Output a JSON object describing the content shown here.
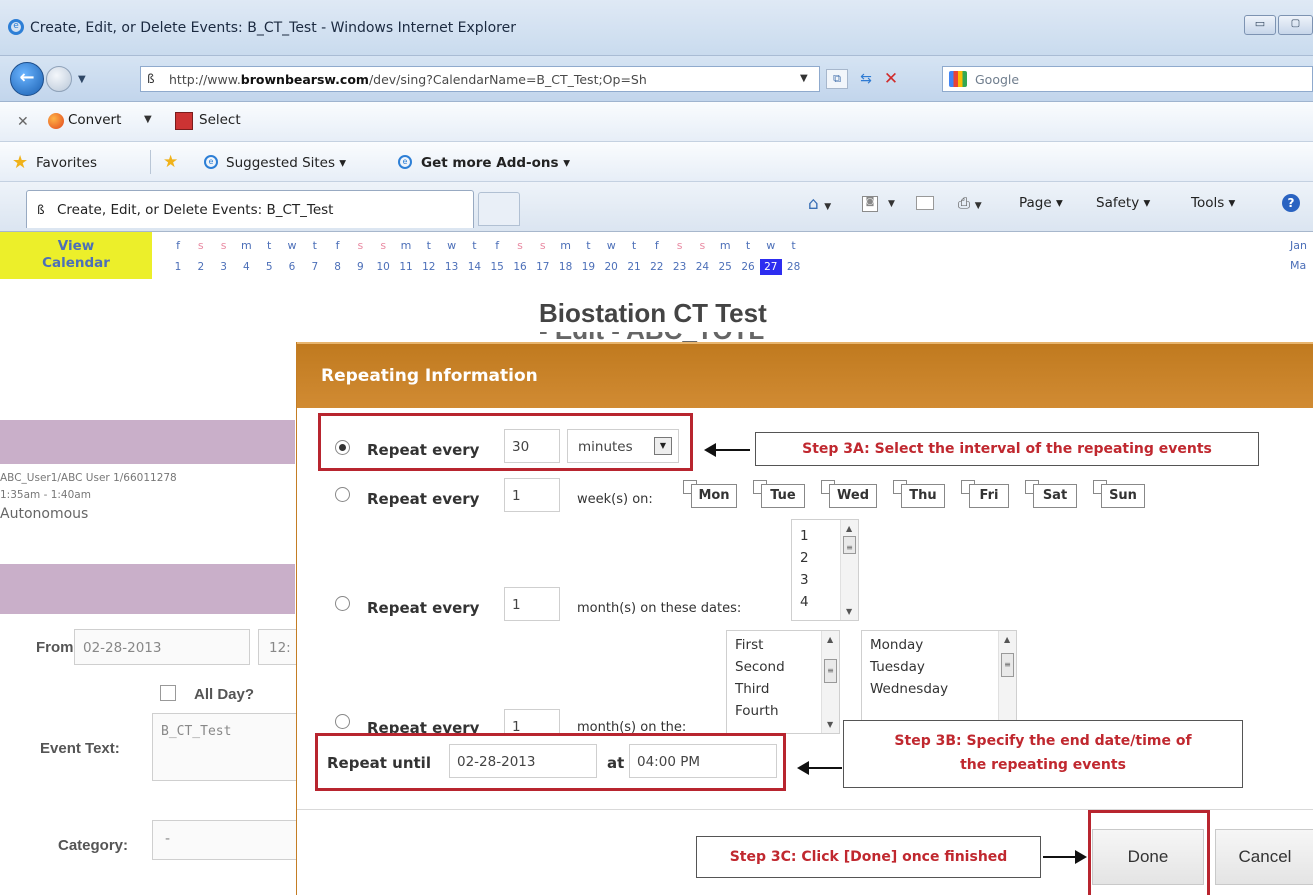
{
  "browser": {
    "window_title": "Create, Edit, or Delete Events: B_CT_Test - Windows Internet Explorer",
    "address_domain": "brownbearsw.com",
    "address_prefix": "http://www.",
    "address_suffix": "/dev/sing?CalendarName=B_CT_Test;Op=Sh",
    "search_placeholder": "Google",
    "cmd_convert": "Convert",
    "cmd_select": "Select",
    "favorites_label": "Favorites",
    "suggested_sites": "Suggested Sites ▾",
    "get_addons": "Get more Add-ons ▾",
    "tab_title": "Create, Edit, or Delete Events: B_CT_Test",
    "menu_page": "Page ▾",
    "menu_safety": "Safety ▾",
    "menu_tools": "Tools ▾"
  },
  "calendar_strip": {
    "view_calendar_line1": "View",
    "view_calendar_line2": "Calendar",
    "days": [
      {
        "letter": "f",
        "num": "1"
      },
      {
        "letter": "s",
        "num": "2",
        "weekend": true
      },
      {
        "letter": "s",
        "num": "3",
        "weekend": true
      },
      {
        "letter": "m",
        "num": "4"
      },
      {
        "letter": "t",
        "num": "5"
      },
      {
        "letter": "w",
        "num": "6"
      },
      {
        "letter": "t",
        "num": "7"
      },
      {
        "letter": "f",
        "num": "8"
      },
      {
        "letter": "s",
        "num": "9",
        "weekend": true
      },
      {
        "letter": "s",
        "num": "10",
        "weekend": true
      },
      {
        "letter": "m",
        "num": "11"
      },
      {
        "letter": "t",
        "num": "12"
      },
      {
        "letter": "w",
        "num": "13"
      },
      {
        "letter": "t",
        "num": "14"
      },
      {
        "letter": "f",
        "num": "15"
      },
      {
        "letter": "s",
        "num": "16",
        "weekend": true
      },
      {
        "letter": "s",
        "num": "17",
        "weekend": true
      },
      {
        "letter": "m",
        "num": "18"
      },
      {
        "letter": "t",
        "num": "19"
      },
      {
        "letter": "w",
        "num": "20"
      },
      {
        "letter": "t",
        "num": "21"
      },
      {
        "letter": "f",
        "num": "22"
      },
      {
        "letter": "s",
        "num": "23",
        "weekend": true
      },
      {
        "letter": "s",
        "num": "24",
        "weekend": true
      },
      {
        "letter": "m",
        "num": "25"
      },
      {
        "letter": "t",
        "num": "26"
      },
      {
        "letter": "w",
        "num": "27",
        "selected": true
      },
      {
        "letter": "t",
        "num": "28"
      }
    ],
    "next_month_top": "Jan",
    "next_month_bottom": "Ma"
  },
  "page": {
    "title": "Biostation CT Test",
    "subtitle": "- Edit - ABC_TOTL",
    "event_user": "ABC_User1/ABC User 1/66011278",
    "event_time": "1:35am - 1:40am",
    "event_type": "Autonomous",
    "from_label": "From:",
    "from_date": "02-28-2013",
    "from_time": "12:",
    "allday_label": "All Day?",
    "event_text_label": "Event Text:",
    "event_text_value": "B_CT_Test",
    "category_label": "Category:",
    "category_value": "-"
  },
  "dialog": {
    "title": "Repeating Information",
    "repeat_every_label": "Repeat every",
    "row1": {
      "value": "30",
      "unit": "minutes",
      "selected": true
    },
    "row2": {
      "value": "1",
      "suffix": "week(s) on:",
      "days": [
        "Mon",
        "Tue",
        "Wed",
        "Thu",
        "Fri",
        "Sat",
        "Sun"
      ]
    },
    "row3": {
      "value": "1",
      "suffix": "month(s) on these dates:",
      "dates": [
        "1",
        "2",
        "3",
        "4"
      ]
    },
    "row4": {
      "value": "1",
      "suffix": "month(s) on the:",
      "ordinals": [
        "First",
        "Second",
        "Third",
        "Fourth"
      ],
      "weekdays": [
        "Monday",
        "Tuesday",
        "Wednesday"
      ]
    },
    "repeat_until_label": "Repeat until",
    "repeat_until_date": "02-28-2013",
    "at_label": "at",
    "repeat_until_time": "04:00 PM",
    "done_button": "Done",
    "cancel_button": "Cancel"
  },
  "annotations": {
    "step3a": "Step 3A: Select the interval of  the repeating events",
    "step3b_line1": "Step 3B: Specify the end date/time of",
    "step3b_line2": "the repeating events",
    "step3c": "Step 3C: Click [Done] once finished",
    "callout_color": "#b8252f"
  }
}
